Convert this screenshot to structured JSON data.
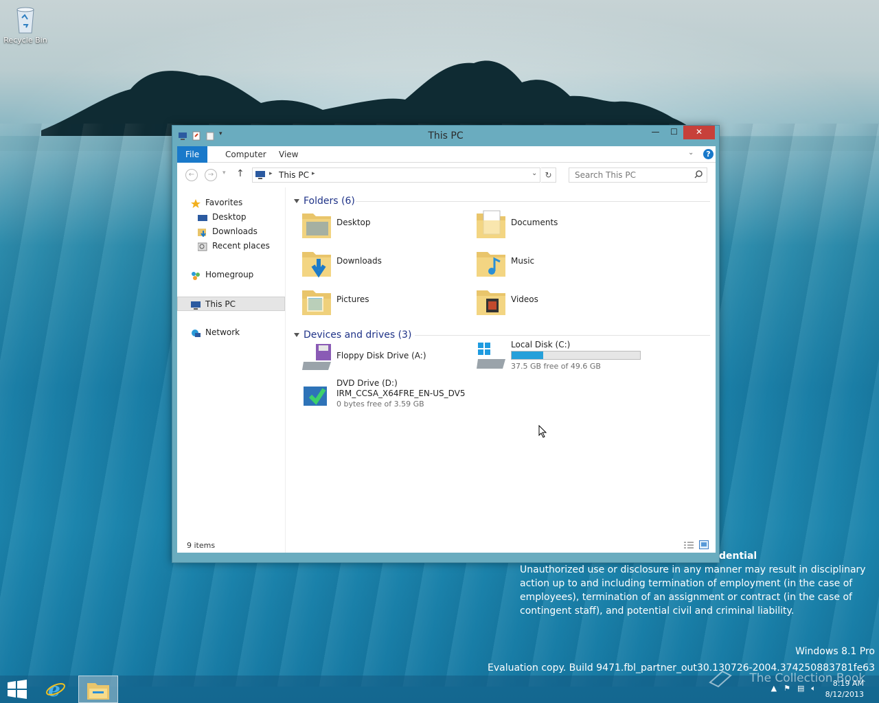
{
  "desktop": {
    "recycle_bin_label": "Recycle Bin"
  },
  "window": {
    "title": "This PC",
    "ribbon_tabs": [
      "File",
      "Computer",
      "View"
    ],
    "address_text": "This PC",
    "search_placeholder": "Search This PC",
    "nav_pane": {
      "favorites": "Favorites",
      "favorites_items": [
        "Desktop",
        "Downloads",
        "Recent places"
      ],
      "homegroup": "Homegroup",
      "this_pc": "This PC",
      "network": "Network"
    },
    "folders_header": "Folders (6)",
    "folders": [
      "Desktop",
      "Documents",
      "Downloads",
      "Music",
      "Pictures",
      "Videos"
    ],
    "devices_header": "Devices and drives (3)",
    "drives": {
      "floppy": "Floppy Disk Drive (A:)",
      "local_disk_name": "Local Disk (C:)",
      "local_disk_free": "37.5 GB free of 49.6 GB",
      "local_disk_used_fraction": 0.244,
      "dvd_name": "DVD Drive (D:)",
      "dvd_label": "IRM_CCSA_X64FRE_EN-US_DV5",
      "dvd_free": "0 bytes free of 3.59 GB"
    },
    "status_items": "9 items"
  },
  "overlay": {
    "confidential_header": "dential",
    "legal_text": "Unauthorized use or disclosure in any manner may result in disciplinary action up to and including termination of employment (in the case of employees), termination of an assignment or contract (in the case of contingent staff), and potential civil and criminal liability.",
    "edition": "Windows 8.1 Pro",
    "build": "Evaluation copy. Build 9471.fbl_partner_out30.130726-2004.374250883781fe63"
  },
  "taskbar": {
    "time": "8:19 AM",
    "date": "8/12/2013",
    "collection_watermark": "The Collection Book"
  },
  "colors": {
    "accent": "#1979ca",
    "close": "#c7403a",
    "group_header": "#1e3287",
    "progress": "#26a0da"
  }
}
